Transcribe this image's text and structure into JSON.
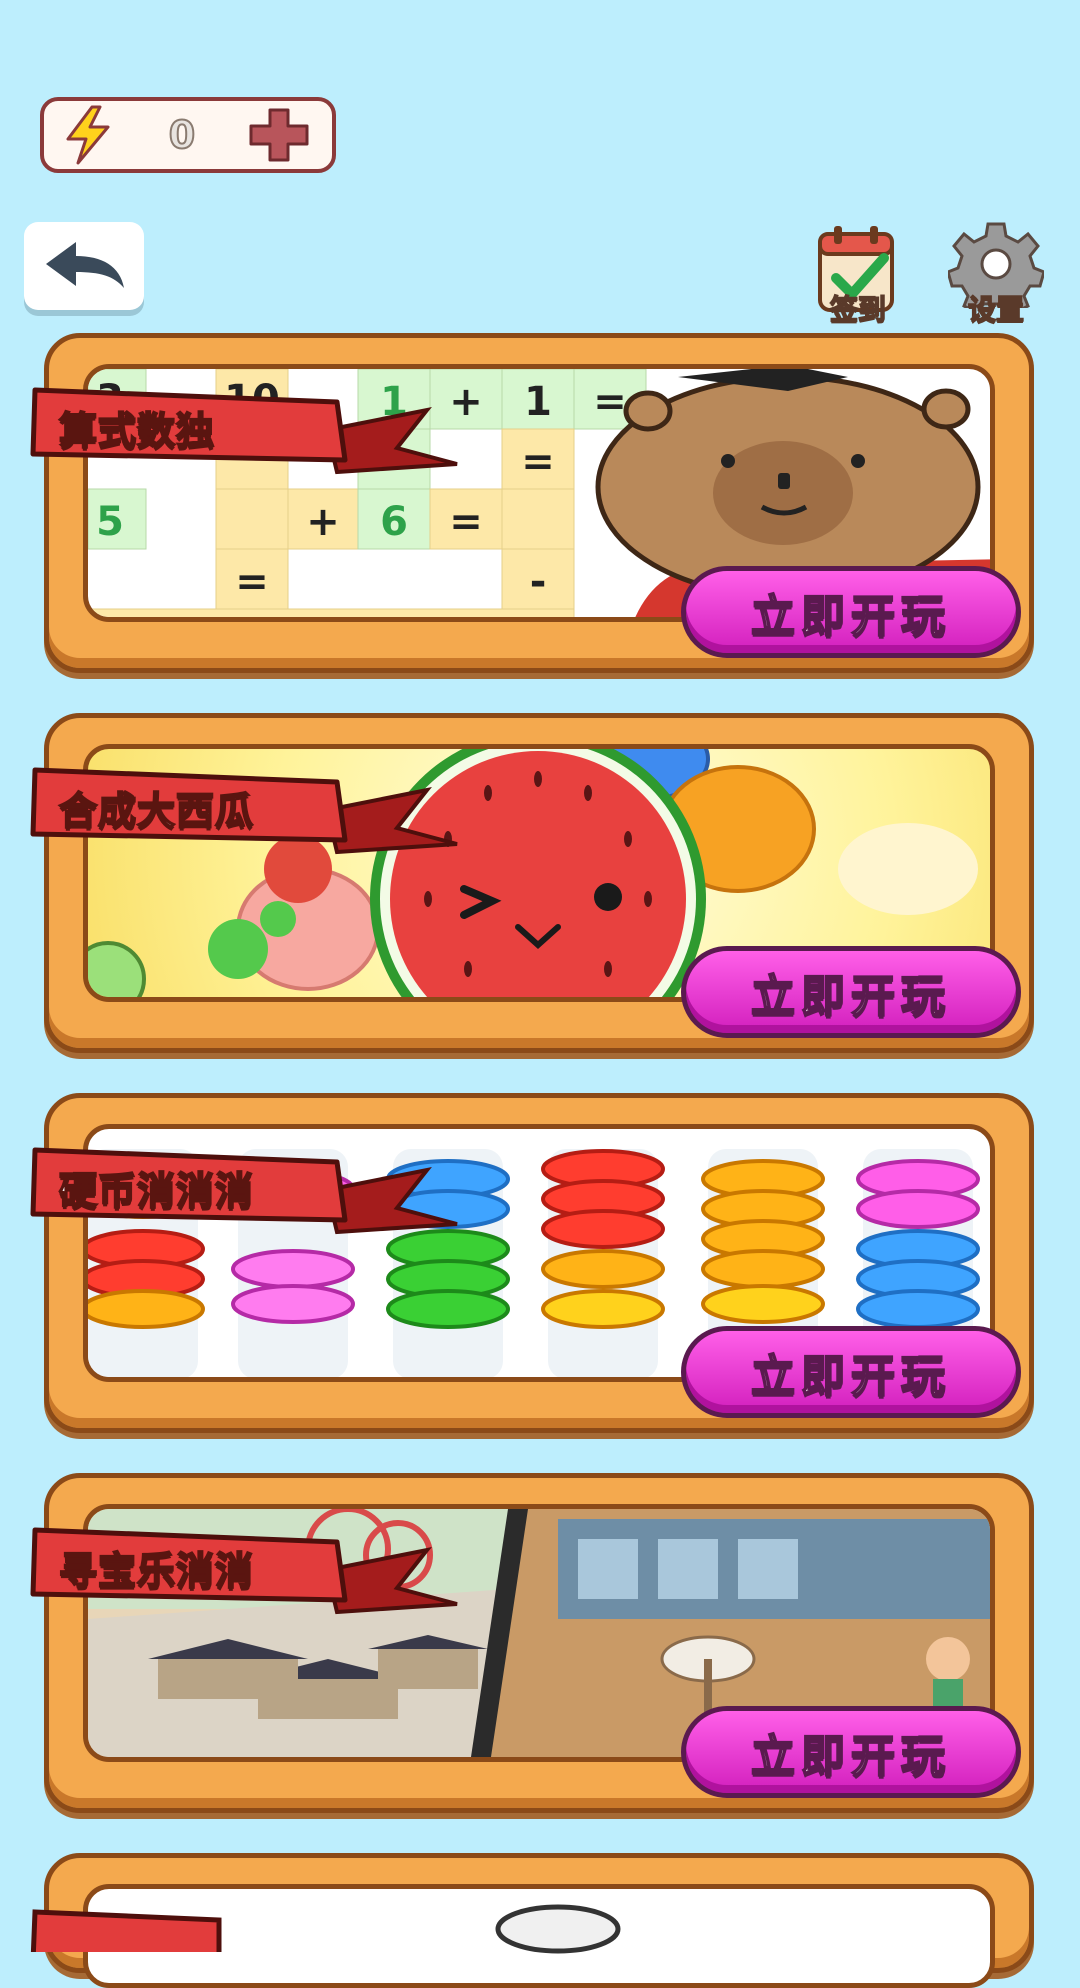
{
  "energy": {
    "count": "0"
  },
  "header": {
    "signin_label": "签到",
    "settings_label": "设置"
  },
  "games": [
    {
      "title": "算式数独",
      "play_label": "立即开玩"
    },
    {
      "title": "合成大西瓜",
      "play_label": "立即开玩"
    },
    {
      "title": "硬币消消消",
      "play_label": "立即开玩"
    },
    {
      "title": "寻宝乐消消",
      "play_label": "立即开玩"
    }
  ],
  "sudoku_cells": [
    "3",
    "10",
    "1",
    "+",
    "1",
    "=",
    "=",
    "=",
    "5",
    "+",
    "6",
    "=",
    "=",
    "-"
  ],
  "colors": {
    "background": "#bdeefd",
    "play_button": "#e43bd0",
    "ribbon": "#e23c3c",
    "frame": "#f4a94e"
  }
}
